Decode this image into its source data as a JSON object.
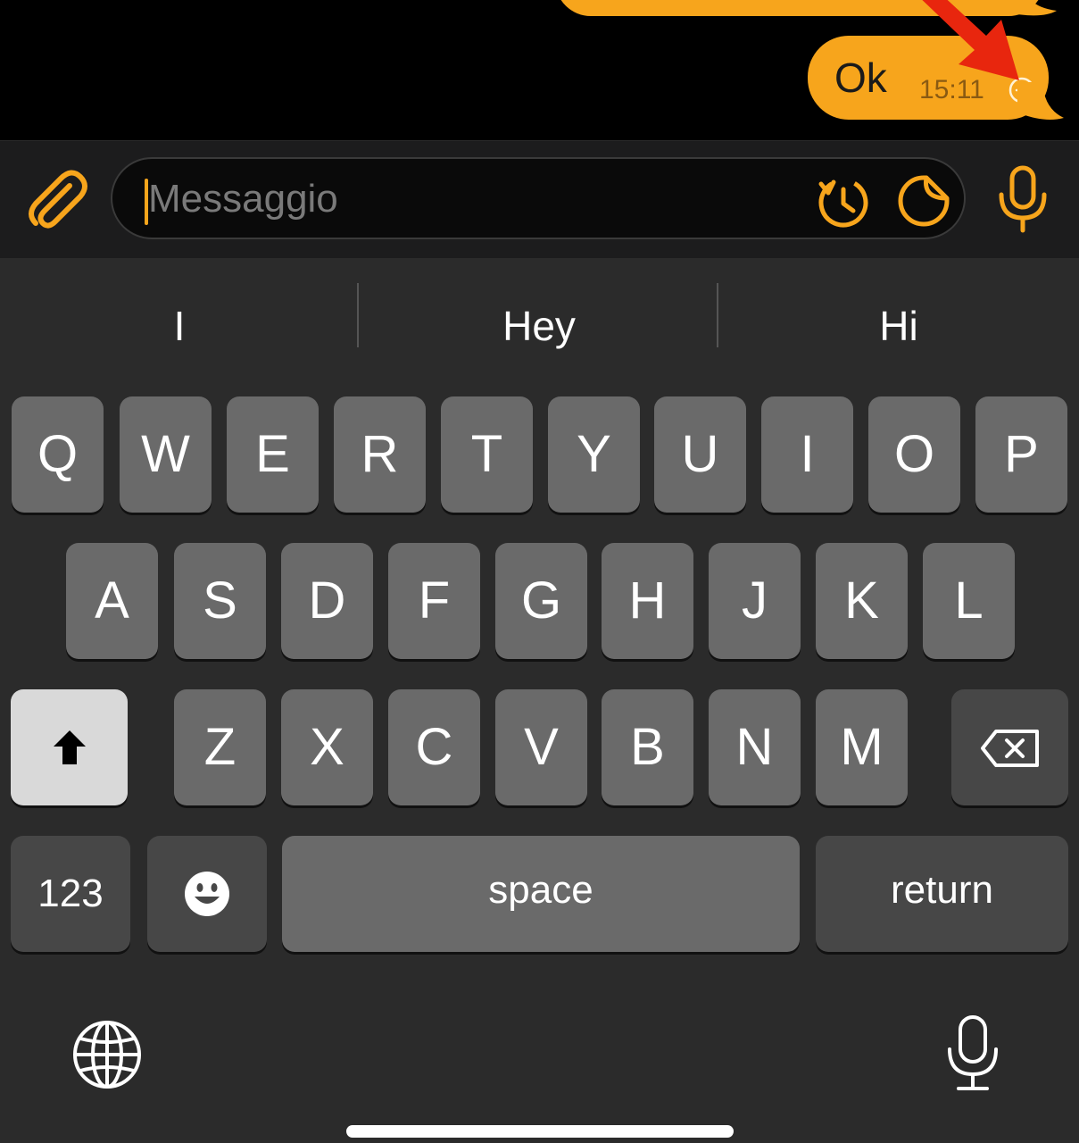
{
  "chat": {
    "message_text": "Ok",
    "message_time": "15:11"
  },
  "input": {
    "placeholder": "Messaggio"
  },
  "keyboard": {
    "suggestions": [
      "I",
      "Hey",
      "Hi"
    ],
    "row1": [
      "Q",
      "W",
      "E",
      "R",
      "T",
      "Y",
      "U",
      "I",
      "O",
      "P"
    ],
    "row2": [
      "A",
      "S",
      "D",
      "F",
      "G",
      "H",
      "J",
      "K",
      "L"
    ],
    "row3": [
      "Z",
      "X",
      "C",
      "V",
      "B",
      "N",
      "M"
    ],
    "numbers_label": "123",
    "space_label": "space",
    "return_label": "return"
  },
  "icons": {
    "attach": "paperclip-icon",
    "timer": "timer-icon",
    "sticker": "sticker-icon",
    "voice": "microphone-icon",
    "shift": "shift-icon",
    "backspace": "backspace-icon",
    "emoji": "emoji-icon",
    "globe": "globe-icon",
    "dictation": "dictation-icon",
    "status": "clock-pending-icon"
  },
  "colors": {
    "accent": "#F7A51C",
    "background": "#000000",
    "keyboard": "#2B2B2B",
    "key": "#6A6A6A",
    "key_dark": "#474747"
  }
}
